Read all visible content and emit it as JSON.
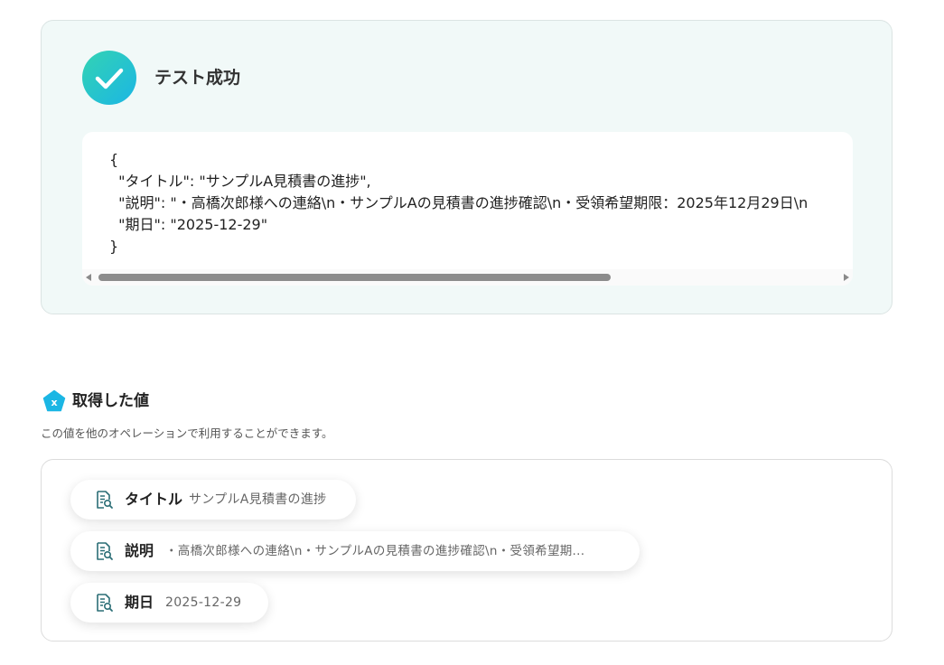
{
  "test_result": {
    "status_icon": "checkmark-icon",
    "title": "テスト成功",
    "code_lines": [
      "{",
      "  \"タイトル\": \"サンプルA見積書の進捗\",",
      "  \"説明\": \"・高橋次郎様への連絡\\n・サンプルAの見積書の進捗確認\\n・受領希望期限：2025年12月29日\\n",
      "  \"期日\": \"2025-12-29\"",
      "}"
    ]
  },
  "retrieved_values": {
    "icon": "pentagon-x-icon",
    "title": "取得した値",
    "subtitle": "この値を他のオペレーションで利用することができます。",
    "items": [
      {
        "icon": "document-search-icon",
        "label": "タイトル",
        "value": "サンプルA見積書の進捗"
      },
      {
        "icon": "document-search-icon",
        "label": "説明",
        "value": "・高橋次郎様への連絡\\n・サンプルAの見積書の進捗確認\\n・受領希望期..."
      },
      {
        "icon": "document-search-icon",
        "label": "期日",
        "value": "2025-12-29"
      }
    ]
  },
  "colors": {
    "accent_gradient_start": "#33d3b3",
    "accent_gradient_end": "#1bb6e4",
    "card_background": "#f1f9f8",
    "pentagon_icon": "#1bb6e4"
  }
}
